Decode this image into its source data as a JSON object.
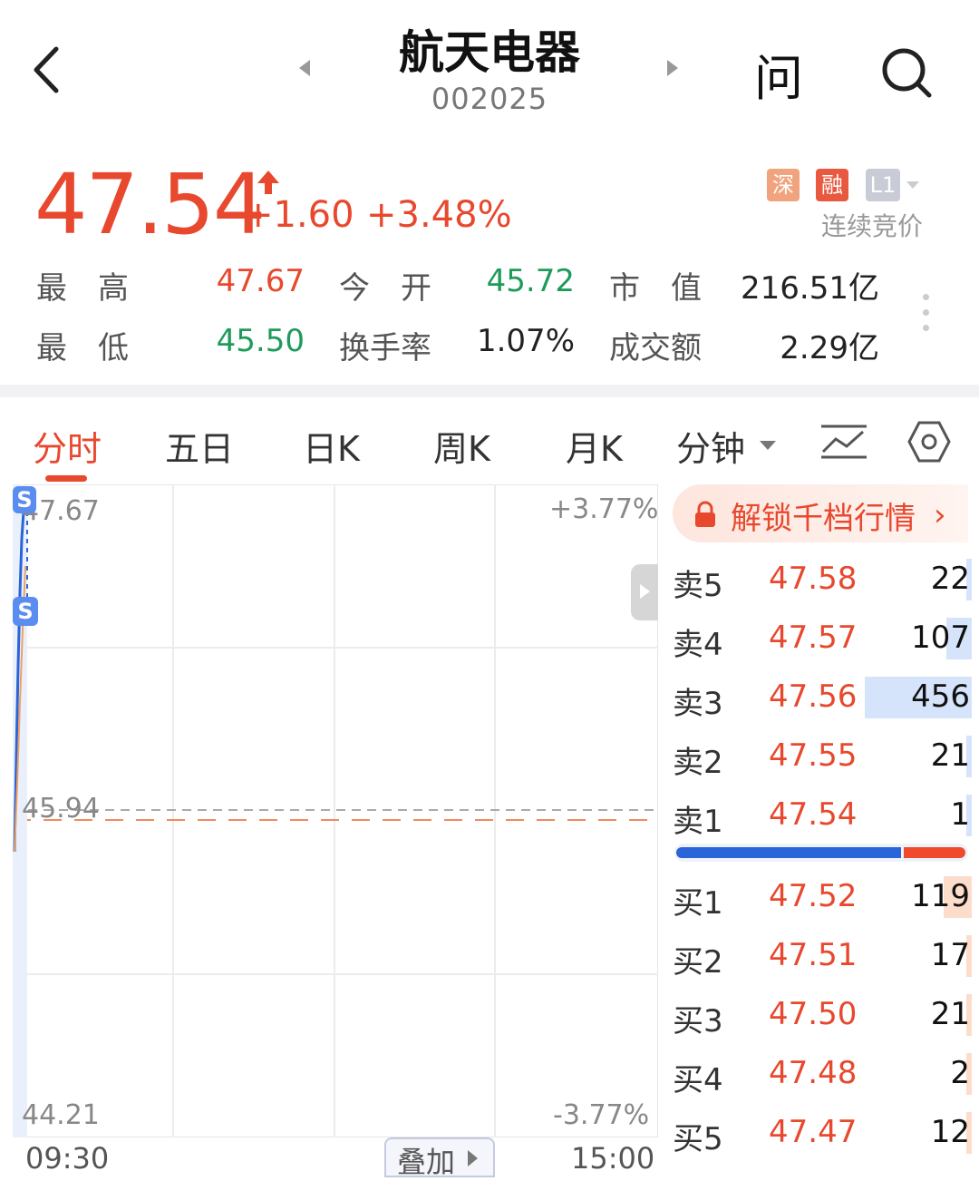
{
  "header": {
    "title": "航天电器",
    "code": "002025",
    "ask_label": "问"
  },
  "quote": {
    "price": "47.54",
    "change": "+1.60",
    "change_pct": "+3.48%",
    "badges": [
      "深",
      "融",
      "L1"
    ],
    "auction_label": "连续竞价"
  },
  "stats": [
    {
      "label": "最　高",
      "value": "47.67",
      "tone": "red"
    },
    {
      "label": "今　开",
      "value": "45.72",
      "tone": "green"
    },
    {
      "label": "市　值",
      "value": "216.51亿",
      "tone": "dark"
    },
    {
      "label": "最　低",
      "value": "45.50",
      "tone": "green"
    },
    {
      "label": "换手率",
      "value": "1.07%",
      "tone": "dark"
    },
    {
      "label": "成交额",
      "value": "2.29亿",
      "tone": "dark"
    }
  ],
  "tabs": [
    "分时",
    "五日",
    "日K",
    "周K",
    "月K",
    "分钟"
  ],
  "chart": {
    "high_label": "47.67",
    "pre_close_label": "45.94",
    "low_label": "44.21",
    "high_pct": "+3.77%",
    "low_pct": "-3.77%",
    "time_start": "09:30",
    "time_end": "15:00",
    "overlay_label": "叠加",
    "marker_glyph": "S"
  },
  "orderbook": {
    "unlock_label": "解锁千档行情",
    "sell": [
      {
        "label": "卖5",
        "price": "47.58",
        "vol": "22",
        "volume": 22
      },
      {
        "label": "卖4",
        "price": "47.57",
        "vol": "107",
        "volume": 107
      },
      {
        "label": "卖3",
        "price": "47.56",
        "vol": "456",
        "volume": 456
      },
      {
        "label": "卖2",
        "price": "47.55",
        "vol": "21",
        "volume": 21
      },
      {
        "label": "卖1",
        "price": "47.54",
        "vol": "1",
        "volume": 1
      }
    ],
    "buy": [
      {
        "label": "买1",
        "price": "47.52",
        "vol": "119",
        "volume": 119
      },
      {
        "label": "买2",
        "price": "47.51",
        "vol": "17",
        "volume": 17
      },
      {
        "label": "买3",
        "price": "47.50",
        "vol": "21",
        "volume": 21
      },
      {
        "label": "买4",
        "price": "47.48",
        "vol": "2",
        "volume": 2
      },
      {
        "label": "买5",
        "price": "47.47",
        "vol": "12",
        "volume": 12
      }
    ],
    "sell_buy_ratio": 0.78
  },
  "colors": {
    "up": "#e8482d",
    "down": "#1e9b5a",
    "accent_blue": "#2a64d9"
  }
}
